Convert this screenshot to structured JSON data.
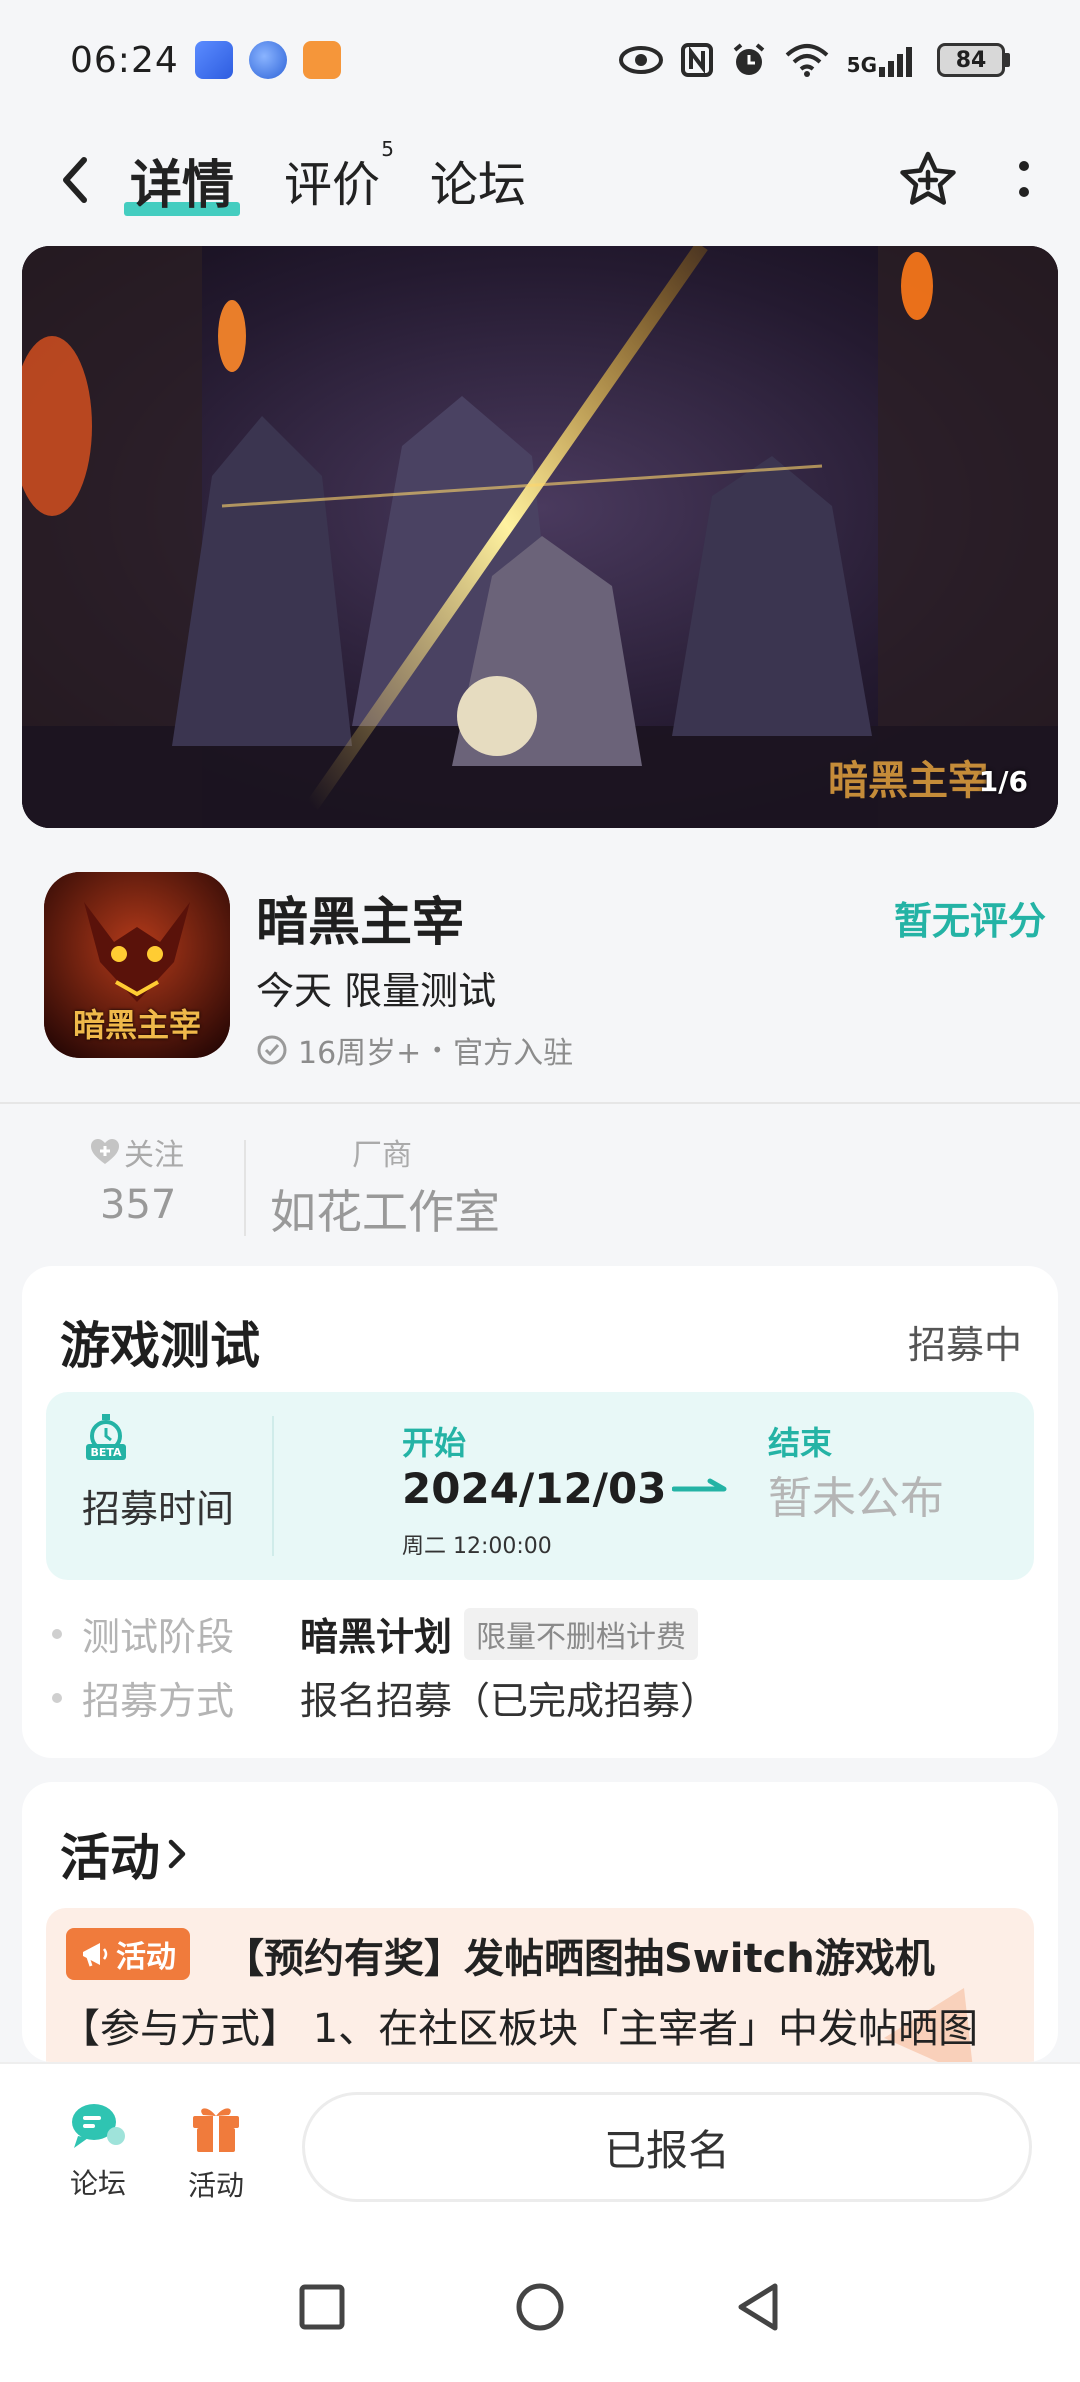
{
  "status_bar": {
    "time": "06:24",
    "network": "5G",
    "battery": "84"
  },
  "nav": {
    "tabs": [
      {
        "label": "详情"
      },
      {
        "label": "评价",
        "badge": "5"
      },
      {
        "label": "论坛"
      }
    ]
  },
  "banner": {
    "watermark": "暗黑主宰",
    "counter": "1/6"
  },
  "game": {
    "icon_text": "暗黑主宰",
    "title": "暗黑主宰",
    "subtitle": "今天 限量测试",
    "age_rating": "16周岁+",
    "separator": "•",
    "official": "官方入驻",
    "score_text": "暂无评分"
  },
  "stats": {
    "follow_label": "关注",
    "follow_count": "357",
    "vendor_label": "厂商",
    "vendor_name": "如花工作室"
  },
  "test_card": {
    "title": "游戏测试",
    "status": "招募中",
    "beta_badge": "BETA",
    "recruit_label": "招募时间",
    "start_label": "开始",
    "start_date": "2024/12/03",
    "start_time": "周二  12:00:00",
    "end_label": "结束",
    "end_value": "暂未公布",
    "rows": [
      {
        "label": "测试阶段",
        "value": "暗黑计划",
        "tag": "限量不删档计费"
      },
      {
        "label": "招募方式",
        "value": "报名招募（已完成招募）"
      }
    ]
  },
  "activity": {
    "title": "活动",
    "badge": "活动",
    "headline": "【预约有奖】发帖晒图抽Switch游戏机",
    "description": "【参与方式】 1、在社区板块「主宰者」中发帖晒图"
  },
  "bottom_bar": {
    "forum_label": "论坛",
    "activity_label": "活动",
    "signup_label": "已报名"
  },
  "colors": {
    "accent": "#24b3a5",
    "activity_orange": "#f07b3c"
  }
}
